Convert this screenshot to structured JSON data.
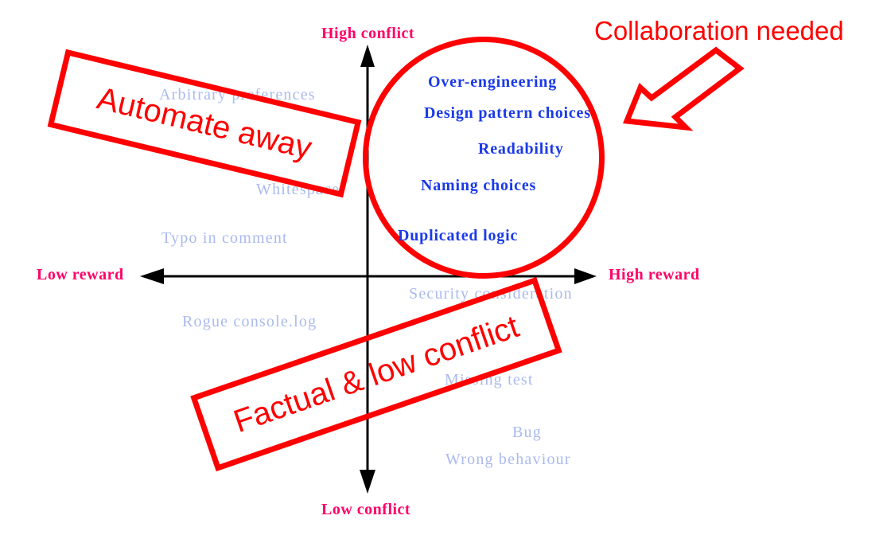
{
  "chart_data": {
    "type": "scatter",
    "title": "",
    "xlabel": "reward",
    "ylabel": "conflict",
    "axes": {
      "x_low_label": "Low reward",
      "x_high_label": "High reward",
      "y_low_label": "Low conflict",
      "y_high_label": "High conflict"
    },
    "grid": false,
    "legend": "none",
    "colors": {
      "axis_label": "#ff0066",
      "muted_item": "#aabaee",
      "highlight_item": "#1a3ae8",
      "annotation": "#ff0000",
      "axis_line": "#000000",
      "background": "#ffffff"
    },
    "points": [
      {
        "label": "Arbitrary preferences",
        "x": -0.58,
        "y": 0.77,
        "emphasis": "muted"
      },
      {
        "label": "Whitespace",
        "x": -0.38,
        "y": 0.38,
        "emphasis": "muted"
      },
      {
        "label": "Typo in comment",
        "x": -0.58,
        "y": 0.16,
        "emphasis": "muted"
      },
      {
        "label": "Rogue console.log",
        "x": -0.5,
        "y": -0.2,
        "emphasis": "muted"
      },
      {
        "label": "Security consideration",
        "x": 0.42,
        "y": -0.08,
        "emphasis": "muted"
      },
      {
        "label": "Missing test",
        "x": 0.55,
        "y": -0.48,
        "emphasis": "muted"
      },
      {
        "label": "Bug",
        "x": 0.72,
        "y": -0.73,
        "emphasis": "muted"
      },
      {
        "label": "Wrong behaviour",
        "x": 0.65,
        "y": -0.86,
        "emphasis": "muted"
      },
      {
        "label": "Over-engineering",
        "x": 0.32,
        "y": 0.85,
        "emphasis": "highlight"
      },
      {
        "label": "Design pattern choices",
        "x": 0.4,
        "y": 0.72,
        "emphasis": "highlight"
      },
      {
        "label": "Readability",
        "x": 0.45,
        "y": 0.53,
        "emphasis": "highlight"
      },
      {
        "label": "Naming choices",
        "x": 0.28,
        "y": 0.38,
        "emphasis": "highlight"
      },
      {
        "label": "Duplicated logic",
        "x": 0.18,
        "y": 0.16,
        "emphasis": "highlight"
      }
    ],
    "annotations": [
      {
        "text": "Collaboration needed",
        "kind": "callout-heading",
        "target": "highlight-circle"
      },
      {
        "text": "Automate away",
        "kind": "stamp-banner",
        "quadrant": "high conflict / low reward"
      },
      {
        "text": "Factual & low conflict",
        "kind": "stamp-banner",
        "quadrant": "low conflict"
      }
    ],
    "shapes": [
      {
        "kind": "circle",
        "name": "highlight-circle",
        "color": "#ff0000",
        "center": [
          0.5,
          0.48
        ],
        "radius": 0.55
      },
      {
        "kind": "block-arrow",
        "name": "callout-arrow",
        "color": "#ff0000",
        "from": [
          0.92,
          0.88
        ],
        "to": [
          0.72,
          0.62
        ]
      }
    ]
  },
  "axes": {
    "high_conflict": "High conflict",
    "low_conflict": "Low conflict",
    "low_reward": "Low reward",
    "high_reward": "High reward"
  },
  "callout": {
    "heading": "Collaboration needed"
  },
  "banners": {
    "automate": "Automate away",
    "factual": "Factual & low conflict"
  },
  "items": {
    "muted": [
      {
        "label": "Arbitrary preferences"
      },
      {
        "label": "Whitespace"
      },
      {
        "label": "Typo in comment"
      },
      {
        "label": "Rogue console.log"
      },
      {
        "label": "Security consideration"
      },
      {
        "label": "Missing test"
      },
      {
        "label": "Bug"
      },
      {
        "label": "Wrong behaviour"
      }
    ],
    "highlight": [
      {
        "label": "Over-engineering"
      },
      {
        "label": "Design pattern choices"
      },
      {
        "label": "Readability"
      },
      {
        "label": "Naming choices"
      },
      {
        "label": "Duplicated logic"
      }
    ]
  }
}
